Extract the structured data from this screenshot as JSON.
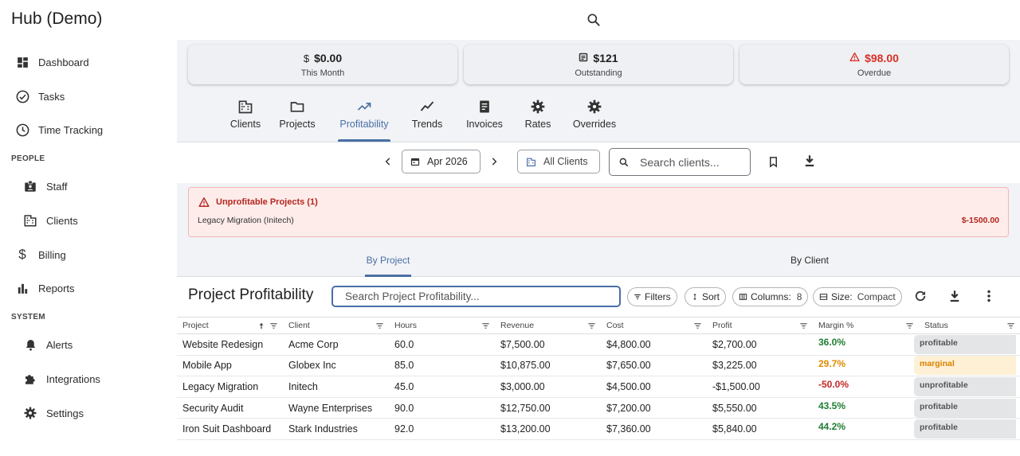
{
  "app": {
    "title": "Hub (Demo)"
  },
  "sidebar": {
    "items": [
      {
        "label": "Dashboard",
        "icon": "dashboard-icon"
      },
      {
        "label": "Tasks",
        "icon": "task-check-icon"
      },
      {
        "label": "Time Tracking",
        "icon": "clock-icon"
      }
    ],
    "section_people": "PEOPLE",
    "people_items": [
      {
        "label": "Staff",
        "icon": "badge-icon"
      },
      {
        "label": "Clients",
        "icon": "building-icon"
      },
      {
        "label": "Billing",
        "icon": "dollar-icon"
      },
      {
        "label": "Reports",
        "icon": "bar-chart-icon"
      }
    ],
    "section_system": "SYSTEM",
    "system_items": [
      {
        "label": "Alerts",
        "icon": "bell-icon"
      },
      {
        "label": "Integrations",
        "icon": "puzzle-icon"
      },
      {
        "label": "Settings",
        "icon": "gear-icon"
      }
    ]
  },
  "kpis": [
    {
      "value": "$0.00",
      "label": "This Month",
      "icon": "dollar-icon"
    },
    {
      "value": "$121",
      "label": "Outstanding",
      "icon": "receipt-icon"
    },
    {
      "value": "$98.00",
      "label": "Overdue",
      "icon": "warning-icon",
      "color": "#d93025"
    }
  ],
  "tabs": [
    {
      "label": "Clients",
      "icon": "building-icon"
    },
    {
      "label": "Projects",
      "icon": "folder-icon"
    },
    {
      "label": "Profitability",
      "icon": "trending-up-icon",
      "active": true
    },
    {
      "label": "Trends",
      "icon": "trend-line-icon"
    },
    {
      "label": "Invoices",
      "icon": "invoice-icon"
    },
    {
      "label": "Rates",
      "icon": "gear-icon"
    },
    {
      "label": "Overrides",
      "icon": "gear-icon"
    }
  ],
  "filters": {
    "month": "Apr 2026",
    "client_select": "All Clients",
    "search_placeholder": "Search clients..."
  },
  "alert": {
    "title": "Unprofitable Projects (1)",
    "item": "Legacy Migration (Initech)",
    "amount": "$-1500.00"
  },
  "subtabs": {
    "by_project": "By Project",
    "by_client": "By Client"
  },
  "table": {
    "title": "Project Profitability",
    "search_placeholder": "Search Project Profitability...",
    "filters_label": "Filters",
    "sort_label": "Sort",
    "columns_label": "Columns:",
    "columns_count": "8",
    "size_label": "Size:",
    "size_value": "Compact",
    "headers": [
      "Project",
      "Client",
      "Hours",
      "Revenue",
      "Cost",
      "Profit",
      "Margin %",
      "Status"
    ],
    "rows": [
      [
        "Website Redesign",
        "Acme Corp",
        "60.0",
        "$7,500.00",
        "$4,800.00",
        "$2,700.00",
        "36.0%",
        "profitable"
      ],
      [
        "Mobile App",
        "Globex Inc",
        "85.0",
        "$10,875.00",
        "$7,650.00",
        "$3,225.00",
        "29.7%",
        "marginal"
      ],
      [
        "Legacy Migration",
        "Initech",
        "45.0",
        "$3,000.00",
        "$4,500.00",
        "-$1,500.00",
        "-50.0%",
        "unprofitable"
      ],
      [
        "Security Audit",
        "Wayne Enterprises",
        "90.0",
        "$12,750.00",
        "$7,200.00",
        "$5,550.00",
        "43.5%",
        "profitable"
      ],
      [
        "Iron Suit Dashboard",
        "Stark Industries",
        "92.0",
        "$13,200.00",
        "$7,360.00",
        "$5,840.00",
        "44.2%",
        "profitable"
      ]
    ],
    "margin_colors": {
      "profitable": "#1e7d32",
      "marginal": "#e08a00",
      "unprofitable": "#c62828"
    }
  }
}
